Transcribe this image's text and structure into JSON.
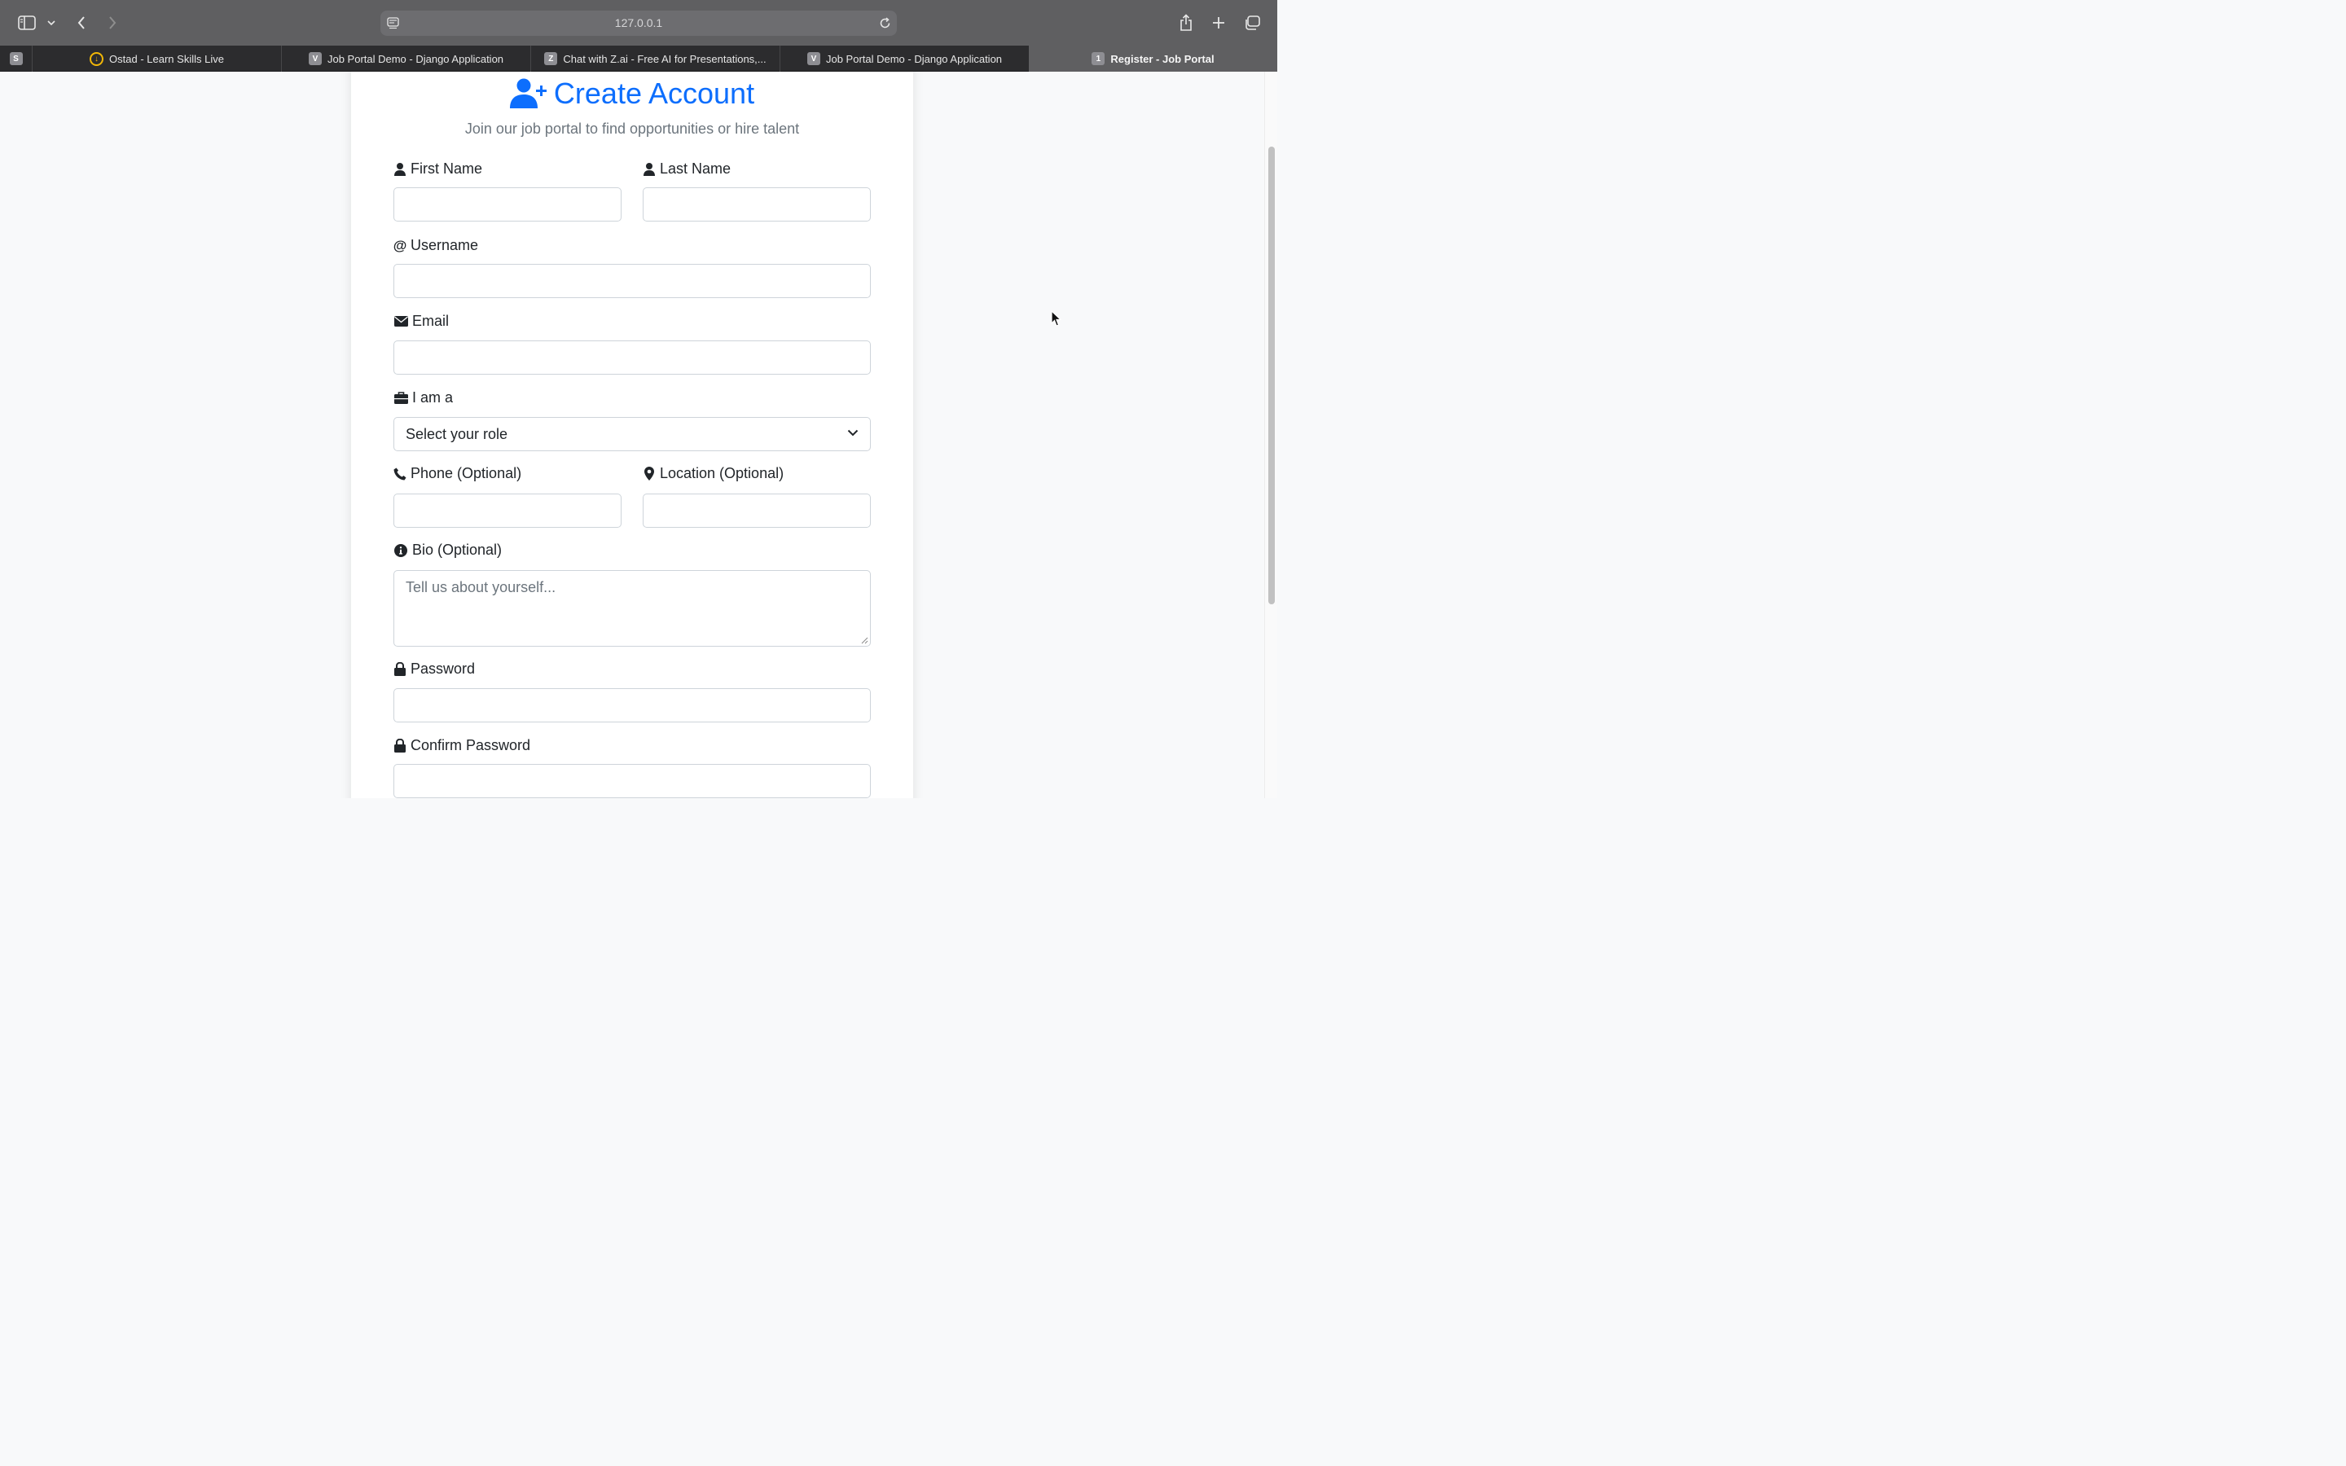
{
  "browser": {
    "url": "127.0.0.1",
    "tabs": [
      {
        "favicon": "S",
        "label": ""
      },
      {
        "favicon": "",
        "label": "Ostad - Learn Skills Live"
      },
      {
        "favicon": "V",
        "label": "Job Portal Demo - Django Application"
      },
      {
        "favicon": "Z",
        "label": "Chat with Z.ai - Free AI for Presentations,..."
      },
      {
        "favicon": "V",
        "label": "Job Portal Demo - Django Application"
      },
      {
        "favicon": "1",
        "label": "Register - Job Portal"
      }
    ]
  },
  "form": {
    "title": "Create Account",
    "subtitle": "Join our job portal to find opportunities or hire talent",
    "first_name_label": "First Name",
    "last_name_label": "Last Name",
    "username_label": "Username",
    "email_label": "Email",
    "role_label": "I am a",
    "role_selected": "Select your role",
    "phone_label": "Phone (Optional)",
    "location_label": "Location (Optional)",
    "bio_label": "Bio (Optional)",
    "bio_placeholder": "Tell us about yourself...",
    "password_label": "Password",
    "confirm_password_label": "Confirm Password"
  },
  "colors": {
    "primary": "#0d6efd",
    "muted": "#6c757d"
  },
  "icons": [
    "sidebar-icon",
    "chevron-down-icon",
    "back-icon",
    "forward-icon",
    "page-settings-icon",
    "reload-icon",
    "share-icon",
    "new-tab-icon",
    "tab-overview-icon",
    "user-plus-icon",
    "user-icon",
    "at-icon",
    "envelope-icon",
    "briefcase-icon",
    "phone-icon",
    "map-marker-icon",
    "info-circle-icon",
    "lock-icon"
  ]
}
